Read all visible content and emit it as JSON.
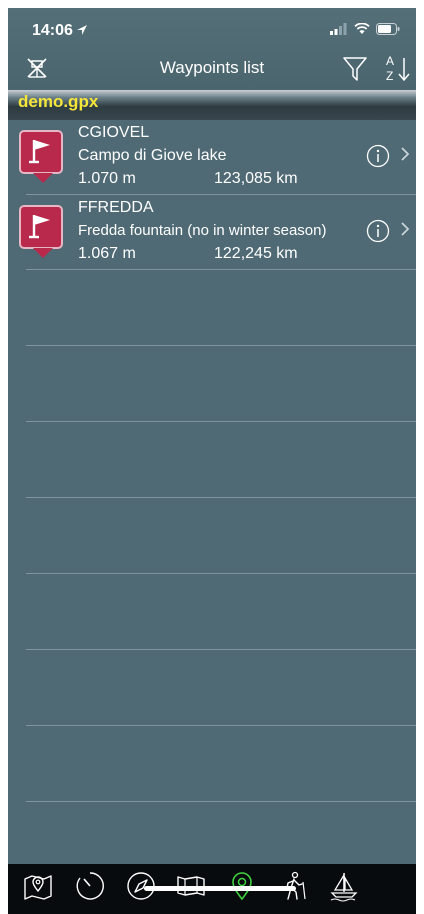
{
  "status": {
    "time": "14:06"
  },
  "header": {
    "title": "Waypoints list"
  },
  "file": {
    "name": "demo.gpx"
  },
  "waypoints": [
    {
      "name": "CGIOVEL",
      "description": "Campo di Giove lake",
      "altitude": "1.070 m",
      "distance": "123,085 km"
    },
    {
      "name": "FFREDDA",
      "description": "Fredda fountain (no in winter season)",
      "altitude": "1.067 m",
      "distance": "122,245 km"
    }
  ],
  "colors": {
    "background": "#4f6a74",
    "accent": "#f5e63a",
    "flag": "#b8294c",
    "tab_active": "#3fd33f"
  },
  "tabs": [
    "map-pin-icon",
    "clock-icon",
    "compass-icon",
    "map-icon",
    "waypoint-icon",
    "hiker-icon",
    "boat-icon"
  ]
}
